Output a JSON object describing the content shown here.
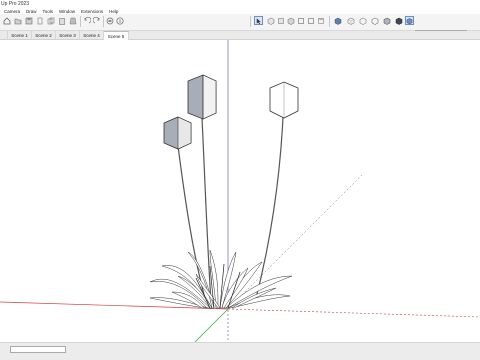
{
  "window": {
    "title": "Up Pro 2023"
  },
  "menu": [
    "Camera",
    "Draw",
    "Tools",
    "Window",
    "Extensions",
    "Help"
  ],
  "toolbar": {
    "left_icons": [
      "house-icon",
      "folder-icon",
      "save-icon",
      "cut-icon",
      "copy-icon",
      "paste-icon",
      "erase-icon",
      "undo-icon",
      "redo-icon",
      "print-icon",
      "info-icon"
    ],
    "right_icons": [
      "select-arrow-icon",
      "iso-view-icon",
      "top-view-icon",
      "front-view-icon",
      "right-view-icon",
      "back-view-icon",
      "left-view-icon",
      "xray-icon",
      "back-edges-icon",
      "wireframe-icon",
      "hidden-line-icon",
      "shaded-icon",
      "shaded-texture-icon",
      "monochrome-icon"
    ]
  },
  "shadows": {
    "months": [
      "J",
      "F",
      "M",
      "A",
      "M",
      "J",
      "J",
      "A",
      "S",
      "O",
      "N",
      "D"
    ],
    "time": "06:38 AM",
    "noon": "Noon",
    "end_time": "07:20 PM"
  },
  "tag": {
    "value": "Untagged"
  },
  "scenes": [
    {
      "label": "Scene 1"
    },
    {
      "label": "Scene 2"
    },
    {
      "label": "Scene 3"
    },
    {
      "label": "Scene 4"
    },
    {
      "label": "Scene 5",
      "active": true
    }
  ],
  "colors": {
    "toolbar_bg": "#f4f4f4",
    "axis_red": "#d33c3c",
    "axis_green": "#35b23a",
    "axis_blue": "#4a4ad6",
    "card_grey": "#a8aeb8",
    "active_tab": "#ffffff"
  }
}
